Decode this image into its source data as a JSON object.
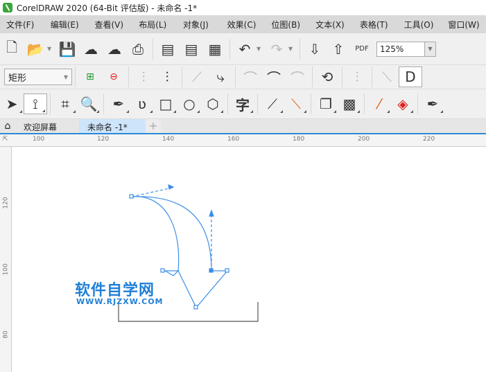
{
  "window": {
    "title": "CorelDRAW 2020 (64-Bit 评估版) - 未命名 -1*"
  },
  "menu": [
    "文件(F)",
    "编辑(E)",
    "查看(V)",
    "布局(L)",
    "对象(J)",
    "效果(C)",
    "位图(B)",
    "文本(X)",
    "表格(T)",
    "工具(O)",
    "窗口(W)"
  ],
  "toolbar": {
    "zoom_value": "125%",
    "pdf_label": "PDF"
  },
  "property_bar": {
    "shape_type": "矩形"
  },
  "toolbox": {
    "text_tool_glyph": "字"
  },
  "tabs": [
    {
      "label": "欢迎屏幕"
    },
    {
      "label": "未命名 -1*"
    }
  ],
  "ruler": {
    "h_labels": [
      "100",
      "120",
      "140",
      "160",
      "180",
      "200",
      "220"
    ],
    "v_labels": [
      "120",
      "100",
      "80"
    ]
  },
  "watermark": {
    "title": "软件自学网",
    "url": "WWW.RJZXW.COM"
  },
  "colors": {
    "accent": "#2b8ad8",
    "curve": "#3a8ee6",
    "menubar": "#d9d9d9"
  }
}
